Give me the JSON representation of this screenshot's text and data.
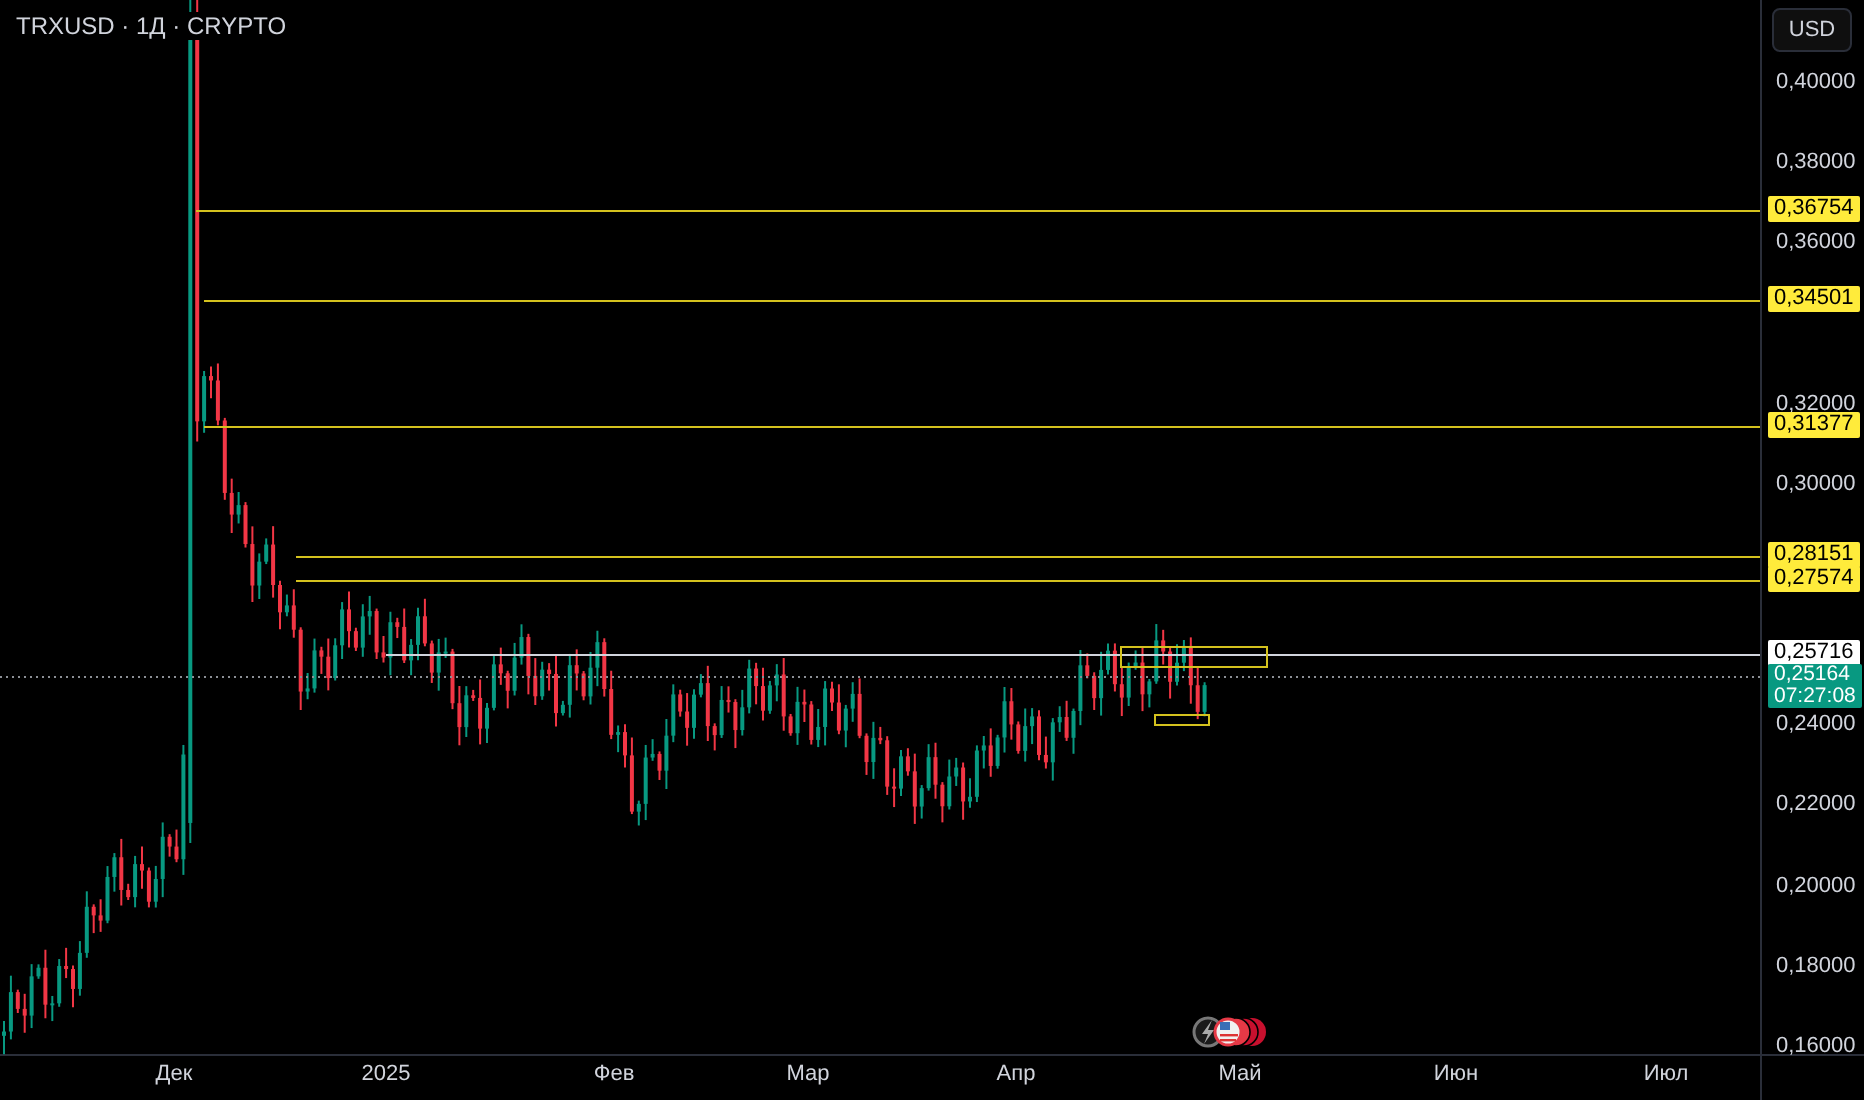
{
  "header": {
    "symbol": "TRXUSD · 1Д · CRYPTO"
  },
  "currency_button": "USD",
  "price_axis": {
    "ticks": [
      "0,40000",
      "0,38000",
      "0,36000",
      "0,32000",
      "0,30000",
      "0,24000",
      "0,22000",
      "0,20000",
      "0,18000",
      "0,16000"
    ]
  },
  "levels": [
    {
      "label": "0,36754",
      "kind": "line"
    },
    {
      "label": "0,34501",
      "kind": "line"
    },
    {
      "label": "0,31377",
      "kind": "line"
    },
    {
      "label": "0,28151",
      "kind": "line"
    },
    {
      "label": "0,27574",
      "kind": "line"
    },
    {
      "label": "0,25716",
      "kind": "marker"
    },
    {
      "label": "0,25164",
      "kind": "current",
      "countdown": "07:27:08"
    }
  ],
  "time_axis": {
    "labels": [
      "Дек",
      "2025",
      "Фев",
      "Мар",
      "Апр",
      "Май",
      "Июн",
      "Июл"
    ]
  }
}
